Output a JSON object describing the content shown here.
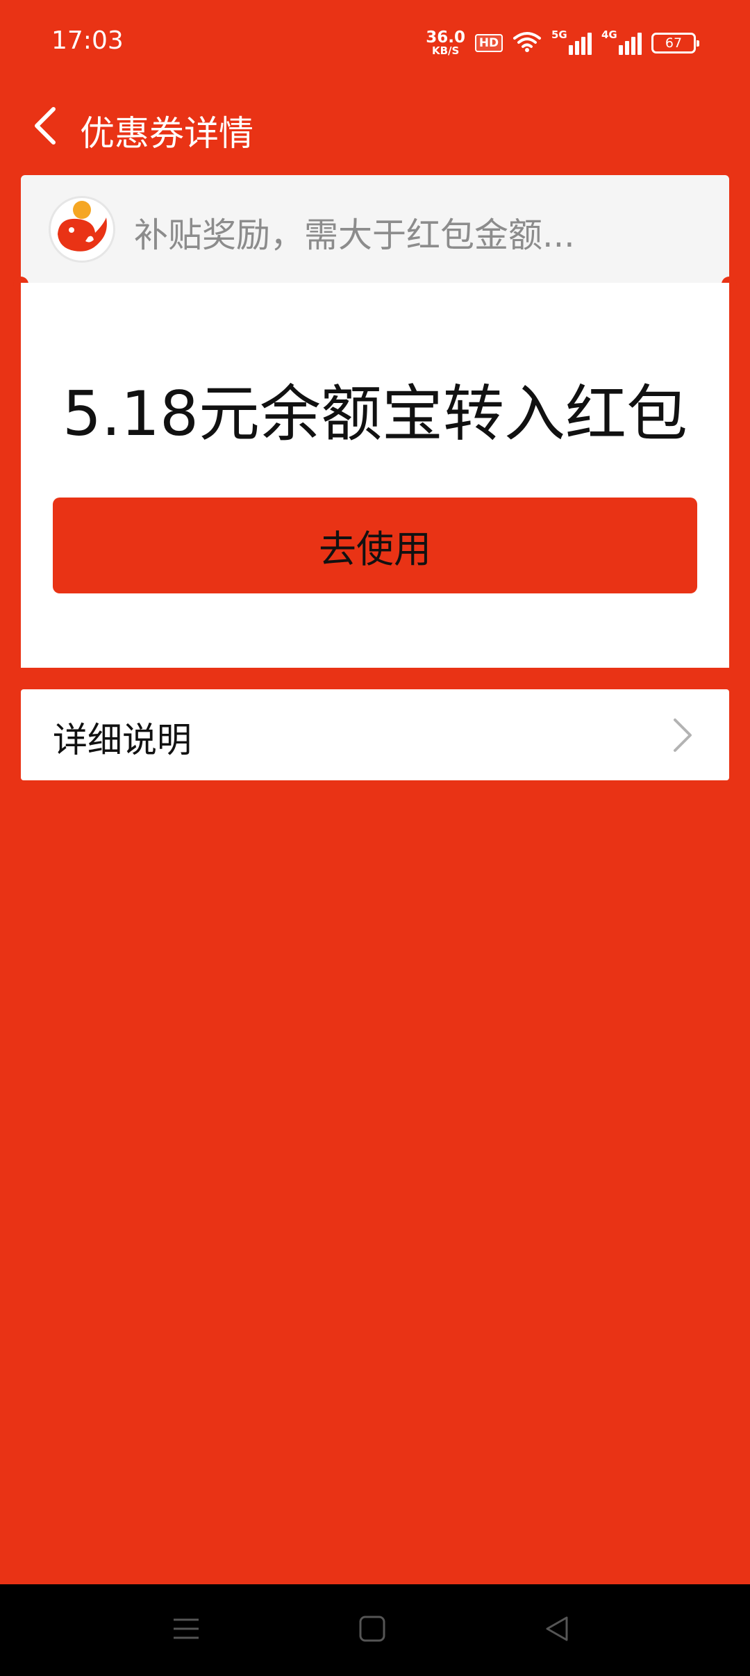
{
  "status_bar": {
    "time": "17:03",
    "net_speed_value": "36.0",
    "net_speed_unit": "KB/S",
    "hd_label": "HD",
    "signal_1": "5G",
    "signal_2": "4G",
    "battery_level": "67"
  },
  "header": {
    "title": "优惠券详情",
    "back_icon": "chevron-left-icon"
  },
  "coupon": {
    "brand_icon": "red-fish-logo-icon",
    "subtitle": "补贴奖励，需大于红包金额...",
    "amount_text": "5.18元余额宝转入红包",
    "use_button_label": "去使用"
  },
  "detail": {
    "label": "详细说明",
    "chevron_icon": "chevron-right-icon"
  },
  "nav_bar": {
    "menu_icon": "menu-icon",
    "home_icon": "home-square-icon",
    "back_icon": "back-triangle-icon"
  },
  "colors": {
    "brand_red": "#e93315",
    "card_header_bg": "#f5f5f5",
    "subtitle_gray": "#8c8c8c",
    "logo_orange": "#f5a623"
  }
}
